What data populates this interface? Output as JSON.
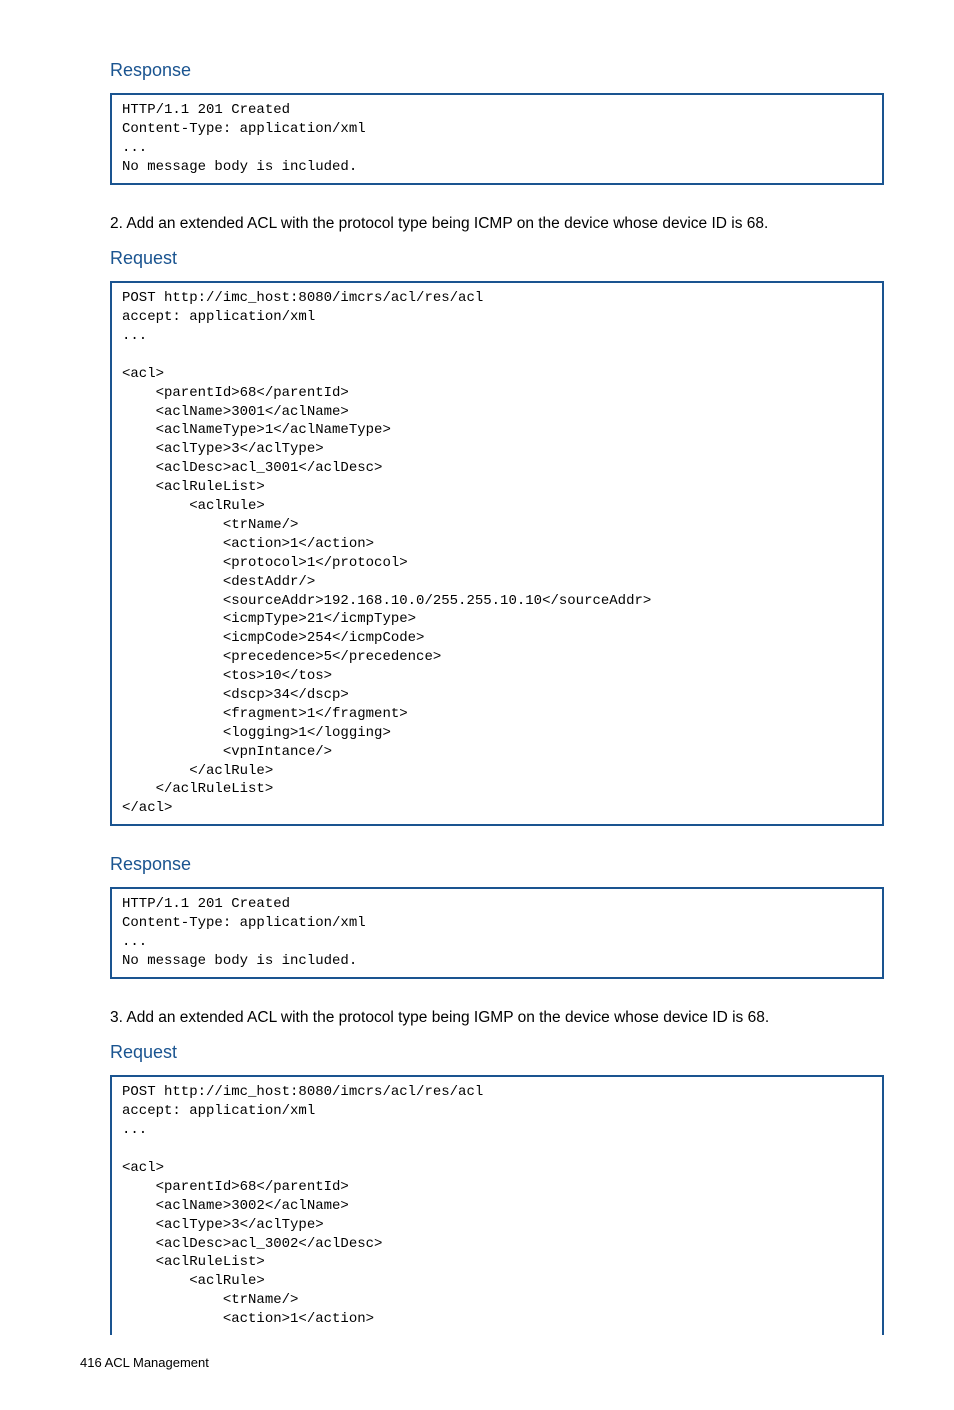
{
  "sections": [
    {
      "heading": "Response",
      "code": "HTTP/1.1 201 Created\nContent-Type: application/xml\n...\nNo message body is included."
    }
  ],
  "paragraph1": "2. Add an extended ACL with the protocol type being ICMP on the device whose device ID is 68.",
  "request1_heading": "Request",
  "request1_code": "POST http://imc_host:8080/imcrs/acl/res/acl\naccept: application/xml\n...\n\n<acl>\n    <parentId>68</parentId>\n    <aclName>3001</aclName>\n    <aclNameType>1</aclNameType>\n    <aclType>3</aclType>\n    <aclDesc>acl_3001</aclDesc>\n    <aclRuleList>\n        <aclRule>\n            <trName/>\n            <action>1</action>\n            <protocol>1</protocol>\n            <destAddr/>\n            <sourceAddr>192.168.10.0/255.255.10.10</sourceAddr>\n            <icmpType>21</icmpType>\n            <icmpCode>254</icmpCode>\n            <precedence>5</precedence>\n            <tos>10</tos>\n            <dscp>34</dscp>\n            <fragment>1</fragment>\n            <logging>1</logging>\n            <vpnIntance/>\n        </aclRule>\n    </aclRuleList>\n</acl>",
  "response2_heading": "Response",
  "response2_code": "HTTP/1.1 201 Created\nContent-Type: application/xml\n...\nNo message body is included.",
  "paragraph2": "3. Add an extended ACL with the protocol type being IGMP on the device whose device ID is 68.",
  "request2_heading": "Request",
  "request2_code": "POST http://imc_host:8080/imcrs/acl/res/acl\naccept: application/xml\n...\n\n<acl>\n    <parentId>68</parentId>\n    <aclName>3002</aclName>\n    <aclType>3</aclType>\n    <aclDesc>acl_3002</aclDesc>\n    <aclRuleList>\n        <aclRule>\n            <trName/>\n            <action>1</action>",
  "footer": "416   ACL Management"
}
